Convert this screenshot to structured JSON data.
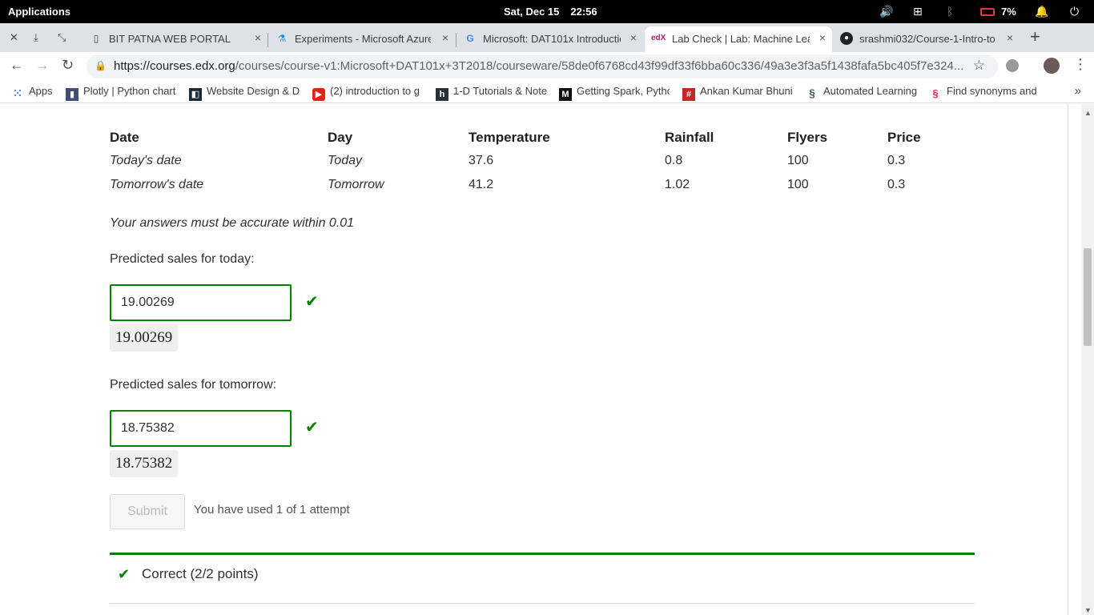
{
  "os_bar": {
    "applications": "Applications",
    "date": "Sat, Dec 15",
    "time": "22:56",
    "battery": "7%"
  },
  "tabs": [
    {
      "title": "BIT PATNA WEB PORTAL",
      "favicon": "page-icon"
    },
    {
      "title": "Experiments - Microsoft Azure",
      "favicon": "flask-icon"
    },
    {
      "title": "Microsoft: DAT101x Introductio",
      "favicon": "google-icon"
    },
    {
      "title": "Lab Check | Lab: Machine Lear",
      "favicon": "edx-icon",
      "active": true
    },
    {
      "title": "srashmi032/Course-1-Intro-to-",
      "favicon": "github-icon"
    }
  ],
  "address_bar": {
    "url_host": "https://courses.edx.org",
    "url_path": "/courses/course-v1:Microsoft+DAT101x+3T2018/courseware/58de0f6768cd43f99df33f6bba60c336/49a3e3f3a5f1438fafa5bc405f7e324..."
  },
  "bookmarks": [
    {
      "label": "Apps",
      "icon": "apps-grid-icon"
    },
    {
      "label": "Plotly | Python chart",
      "icon": "plotly-icon"
    },
    {
      "label": "Website Design & D",
      "icon": "website-icon"
    },
    {
      "label": "(2) introduction to g",
      "icon": "youtube-icon"
    },
    {
      "label": "1-D Tutorials & Note",
      "icon": "h-icon"
    },
    {
      "label": "Getting Spark, Pytho",
      "icon": "medium-icon"
    },
    {
      "label": "Ankan Kumar Bhuni",
      "icon": "hash-icon"
    },
    {
      "label": "Automated Learning",
      "icon": "dna-icon"
    },
    {
      "label": "Find synonyms and",
      "icon": "synonym-icon"
    }
  ],
  "table": {
    "headers": [
      "Date",
      "Day",
      "Temperature",
      "Rainfall",
      "Flyers",
      "Price"
    ],
    "rows": [
      [
        "Today's date",
        "Today",
        "37.6",
        "0.8",
        "100",
        "0.3"
      ],
      [
        "Tomorrow's date",
        "Tomorrow",
        "41.2",
        "1.02",
        "100",
        "0.3"
      ]
    ]
  },
  "accuracy_note": "Your answers must be accurate within 0.01",
  "questions": [
    {
      "label": "Predicted sales for today:",
      "value": "19.00269",
      "preview": "19.00269"
    },
    {
      "label": "Predicted sales for tomorrow:",
      "value": "18.75382",
      "preview": "18.75382"
    }
  ],
  "submit_label": "Submit",
  "attempts_text": "You have used 1 of 1 attempt",
  "result": {
    "text": "Correct (2/2 points)",
    "color": "#008100"
  }
}
